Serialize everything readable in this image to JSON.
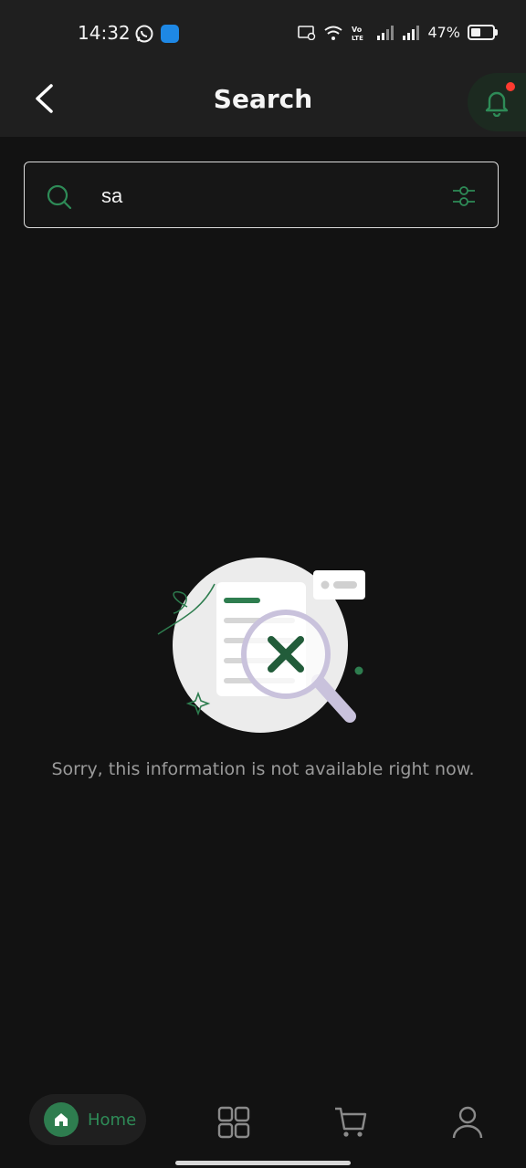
{
  "status_bar": {
    "time": "14:32",
    "battery_text": "47%",
    "battery_level": 0.47,
    "icons": [
      "whatsapp-icon",
      "app-icon",
      "cast-icon",
      "wifi-icon",
      "volte-icon",
      "signal-icon",
      "signal-icon",
      "battery-icon"
    ]
  },
  "header": {
    "title": "Search",
    "back_icon": "back-arrow-icon",
    "bell_icon": "notification-bell-icon"
  },
  "search": {
    "value": "sa",
    "placeholder": "",
    "icon": "search-icon",
    "filter_icon": "filter-sliders-icon"
  },
  "empty_state": {
    "message": "Sorry, this information is not available right now."
  },
  "bottom_nav": {
    "items": [
      {
        "label": "Home",
        "icon": "home-icon",
        "active": true
      },
      {
        "label": "",
        "icon": "grid-icon",
        "active": false
      },
      {
        "label": "",
        "icon": "cart-icon",
        "active": false
      },
      {
        "label": "",
        "icon": "profile-icon",
        "active": false
      }
    ]
  },
  "colors": {
    "background": "#121212",
    "accent": "#2e7d4f",
    "badge": "#ff3b30"
  }
}
